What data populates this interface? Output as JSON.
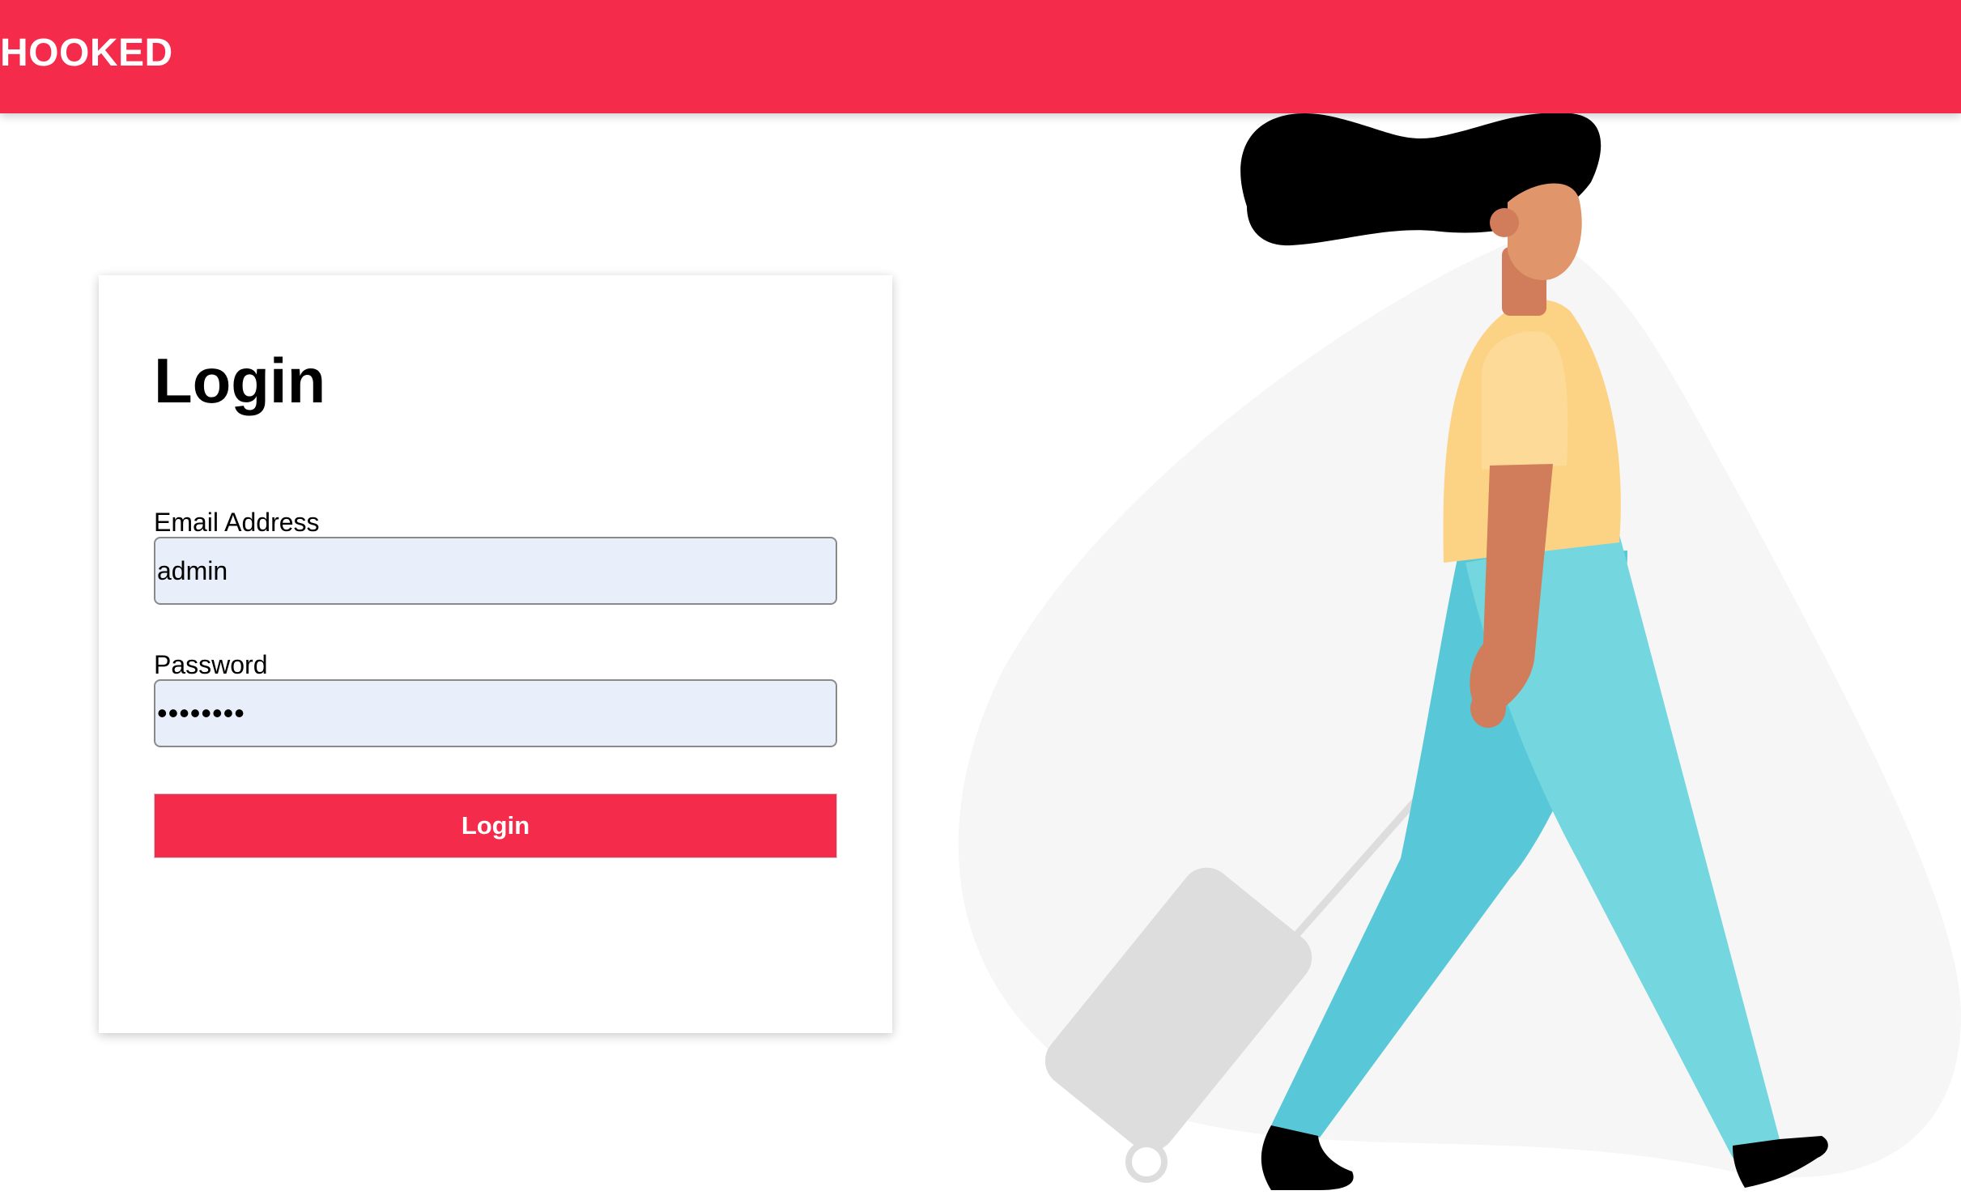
{
  "app": {
    "brand": "HOOKED"
  },
  "login_form": {
    "title": "Login",
    "email": {
      "label": "Email Address",
      "value": "admin"
    },
    "password": {
      "label": "Password",
      "value": "••••••••"
    },
    "submit_label": "Login"
  },
  "colors": {
    "accent": "#f52b4c",
    "input_background": "#e8effb",
    "illustration_blob": "#f6f6f6",
    "shirt": "#fcd385",
    "pants": "#74d6de",
    "pants_shadow": "#58c8d8",
    "skin": "#e0956a",
    "skin_dark": "#d17c5a",
    "hair": "#000000",
    "suitcase": "#dddddd"
  },
  "icons": {
    "illustration": "woman-walking-with-suitcase-illustration"
  }
}
